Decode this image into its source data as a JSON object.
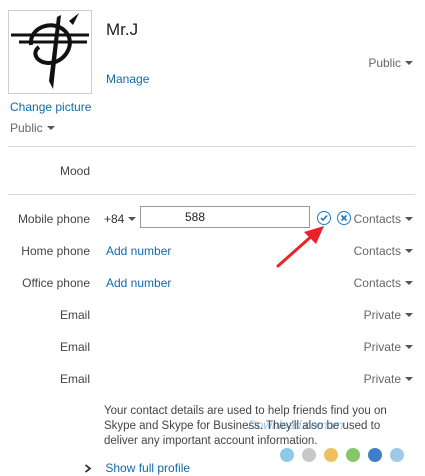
{
  "profile": {
    "name": "Mr.J",
    "manage": "Manage",
    "change_picture": "Change picture",
    "picture_visibility": "Public",
    "name_visibility": "Public"
  },
  "fields": {
    "mood": {
      "label": "Mood"
    },
    "mobile": {
      "label": "Mobile phone",
      "country_code": "+84",
      "value": "588",
      "visibility": "Contacts"
    },
    "home": {
      "label": "Home phone",
      "action": "Add number",
      "visibility": "Contacts"
    },
    "office": {
      "label": "Office phone",
      "action": "Add number",
      "visibility": "Contacts"
    },
    "emails": [
      {
        "label": "Email",
        "visibility": "Private"
      },
      {
        "label": "Email",
        "visibility": "Private"
      },
      {
        "label": "Email",
        "visibility": "Private"
      }
    ]
  },
  "info_text": "Your contact details are used to help friends find you on Skype and Skype for Business. They'll also be used to deliver any important account information.",
  "show_full_profile": "Show full profile",
  "watermark": "Download.com.vn",
  "colors": {
    "link": "#0f6ba8",
    "accent": "#1f7ac4",
    "arrow": "#e8232a"
  },
  "icons": [
    "confirm-check-icon",
    "cancel-x-icon",
    "chevron-right-icon",
    "annotation-arrow"
  ]
}
